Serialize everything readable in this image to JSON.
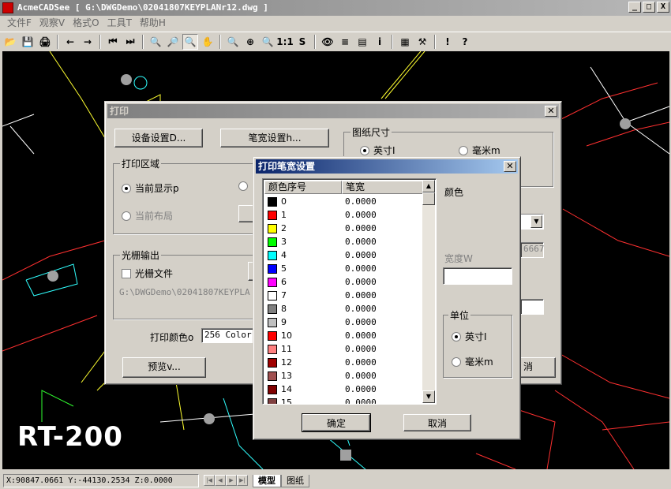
{
  "app": {
    "title": "AcmeCADSee [ G:\\DWGDemo\\02041807KEYPLANr12.dwg ]",
    "min_glyph": "_",
    "max_glyph": "□",
    "close_glyph": "X"
  },
  "menu": [
    "文件F",
    "观察V",
    "格式O",
    "工具T",
    "帮助H"
  ],
  "toolbar": [
    {
      "icon": "open-folder-icon",
      "glyph": "📂"
    },
    {
      "icon": "save-icon",
      "glyph": "💾"
    },
    {
      "icon": "print-icon",
      "glyph": "🖨"
    },
    {
      "icon": "back-arrow-icon",
      "glyph": "←"
    },
    {
      "icon": "forward-arrow-icon",
      "glyph": "→"
    },
    {
      "icon": "first-page-icon",
      "glyph": "⏮"
    },
    {
      "icon": "last-page-icon",
      "glyph": "⏭"
    },
    {
      "icon": "zoom-out-icon",
      "glyph": "🔍"
    },
    {
      "icon": "zoom-in-icon",
      "glyph": "🔎"
    },
    {
      "icon": "zoom-window-icon",
      "glyph": "🔍"
    },
    {
      "icon": "pan-icon",
      "glyph": "✋"
    },
    {
      "icon": "zoom-realtime-icon",
      "glyph": "🔍"
    },
    {
      "icon": "zoom-extents-icon",
      "glyph": "⊕"
    },
    {
      "icon": "zoom-all-icon",
      "glyph": "🔍"
    },
    {
      "icon": "actual-size-icon",
      "glyph": "1:1"
    },
    {
      "icon": "snapshot-icon",
      "glyph": "S"
    },
    {
      "icon": "eye-icon",
      "glyph": "👁"
    },
    {
      "icon": "layers-icon",
      "glyph": "≡"
    },
    {
      "icon": "properties-icon",
      "glyph": "▤"
    },
    {
      "icon": "info-icon",
      "glyph": "i"
    },
    {
      "icon": "document-icon",
      "glyph": "▦"
    },
    {
      "icon": "tools-icon",
      "glyph": "⚒"
    },
    {
      "icon": "exclamation-icon",
      "glyph": "!"
    },
    {
      "icon": "help-icon",
      "glyph": "?"
    }
  ],
  "status": {
    "coords": "X:90847.0661 Y:-44130.2534 Z:0.0000",
    "nav": [
      "|◀",
      "◀",
      "▶",
      "▶|"
    ],
    "tabs": [
      "模型",
      "图纸"
    ]
  },
  "logo": "RT-200",
  "print_dialog": {
    "title": "打印",
    "device_button": "设备设置D...",
    "pen_button": "笔宽设置h...",
    "paper_size_group": "图纸尺寸",
    "inch": "英寸I",
    "mm": "毫米m",
    "area_group": "打印区域",
    "current_display": "当前显示p",
    "current_layout": "当前布局",
    "raster_group": "光栅输出",
    "raster_file": "光栅文件",
    "raster_path": "G:\\DWGDemo\\02041807KEYPLA",
    "print_color_label": "打印颜色o",
    "print_color_value": "256 Color",
    "preview_button": "预览v...",
    "cancel_partial": "消",
    "partial_field": "6667"
  },
  "pen_dialog": {
    "title": "打印笔宽设置",
    "col_index": "颜色序号",
    "col_width": "笔宽",
    "color_label": "颜色",
    "width_label": "宽度W",
    "unit_group": "单位",
    "inch": "英寸I",
    "mm": "毫米m",
    "ok": "确定",
    "cancel": "取消",
    "rows": [
      {
        "idx": "0",
        "color": "#000000",
        "width": "0.0000"
      },
      {
        "idx": "1",
        "color": "#ff0000",
        "width": "0.0000"
      },
      {
        "idx": "2",
        "color": "#ffff00",
        "width": "0.0000"
      },
      {
        "idx": "3",
        "color": "#00ff00",
        "width": "0.0000"
      },
      {
        "idx": "4",
        "color": "#00ffff",
        "width": "0.0000"
      },
      {
        "idx": "5",
        "color": "#0000ff",
        "width": "0.0000"
      },
      {
        "idx": "6",
        "color": "#ff00ff",
        "width": "0.0000"
      },
      {
        "idx": "7",
        "color": "#ffffff",
        "width": "0.0000"
      },
      {
        "idx": "8",
        "color": "#808080",
        "width": "0.0000"
      },
      {
        "idx": "9",
        "color": "#c0c0c0",
        "width": "0.0000"
      },
      {
        "idx": "10",
        "color": "#ff0000",
        "width": "0.0000"
      },
      {
        "idx": "11",
        "color": "#ff8080",
        "width": "0.0000"
      },
      {
        "idx": "12",
        "color": "#a00000",
        "width": "0.0000"
      },
      {
        "idx": "13",
        "color": "#a05050",
        "width": "0.0000"
      },
      {
        "idx": "14",
        "color": "#800000",
        "width": "0.0000"
      },
      {
        "idx": "15",
        "color": "#804040",
        "width": "0.0000"
      }
    ]
  }
}
